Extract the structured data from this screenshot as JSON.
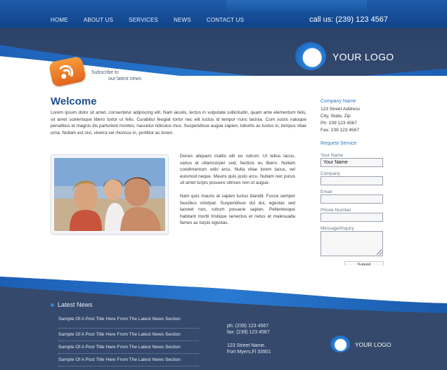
{
  "nav": {
    "items": [
      "HOME",
      "ABOUT US",
      "SERVICES",
      "NEWS",
      "CONTACT US"
    ],
    "phone": "call us: (239) 123 4567"
  },
  "logo": {
    "text": "YOUR LOGO"
  },
  "subscribe": {
    "line1": "Subscribe to",
    "line2": "our latest news"
  },
  "main": {
    "title": "Welcome",
    "intro": "Lorem ipsum dolor sit amet, consectetur adipiscing elit. Nam iaculis, lectus in vulputate sollicitudin, quam ante elementum felis, sit amet scelerisque libero tortor ut felis. Curabitur feugiat tortor nec elit luctus id tempor nunc lacinia. Cum sociis natoque penatibus et magnis dis parturient montes, nascetur ridiculus mus. Suspendisse augue sapien, lobortis ac luctus in, tempus vitae urna. Nullam est nisi, viverra vel rhoncus in, porttitor ac lorem.",
    "para2": "Donec aliquam mattis elit eu rutrum. Ut tellus lacus, varius et ullamcorper sed, facilisis eu libero. Nullam condimentum odio arcu. Nulla vitae lorem lacus, vel euismod neque. Mauris quis justo arcu. Nullam nec purus sit amet turpis posuere ultrices non ut augue.",
    "para3": "Nam quis mauris at sapien luctus blandit. Fusce semper faucibus volutpat. Suspendisse dui dui, egestas sed laoreet non, rutrum posuere sapien. Pellentesque habitant morbi tristique senectus et netus et malesuada fames ac turpis egestas."
  },
  "sidebar": {
    "company_heading": "Company Name",
    "address_lines": [
      "123 Street Address",
      "City, State, Zip",
      "Ph: 239 123 4567",
      "Fax: 239 123 4567"
    ],
    "request_heading": "Request Service",
    "form": {
      "name_label": "Your Name",
      "name_value": "Your Name",
      "company_label": "Company",
      "email_label": "Email",
      "phone_label": "Phone Number",
      "message_label": "Message/Inquiry",
      "submit_label": "Submit"
    }
  },
  "footer": {
    "news_heading": "Latest News",
    "news_items": [
      "Sample Of A Post Title Here From The Latest News Section",
      "Sample Of A Post Title Here From The Latest News Section",
      "Sample Of A Post Title Here From The Latest News Section",
      "Sample Of A Post Title Here From The Latest News Section"
    ],
    "phone": "ph: (239) 123 4567",
    "fax": "fax: (239) 123 4567",
    "address1": "123 Street Name.",
    "address2": "Fort Myers,Fl 33901",
    "logo_text": "YOUR LOGO"
  },
  "colors": {
    "brand_blue": "#1e5aa8",
    "heading_blue": "#1f4f8c",
    "link_blue": "#2f78c2",
    "rss_orange": "#e1651e",
    "footer_bg": "#34496b"
  }
}
